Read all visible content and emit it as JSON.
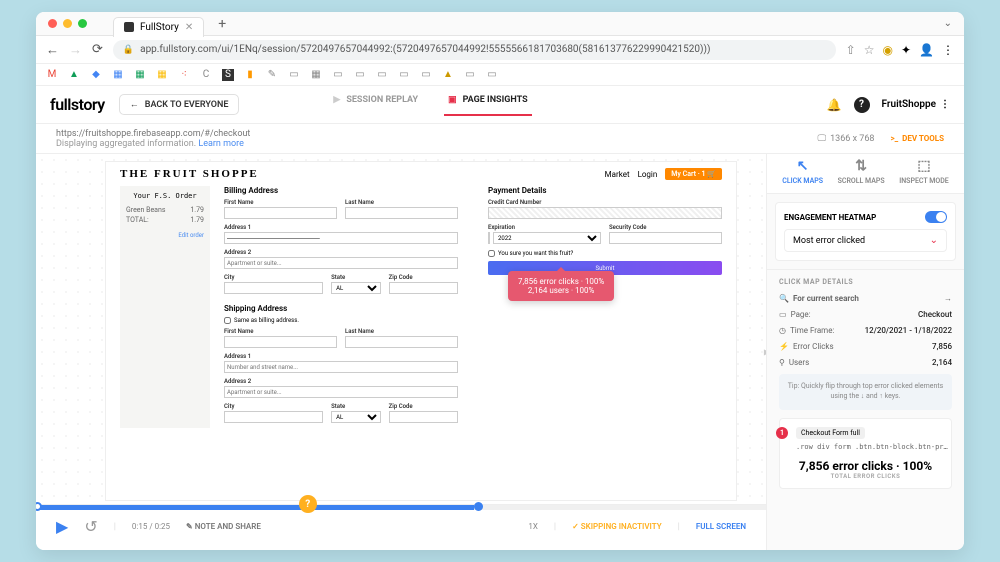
{
  "browser": {
    "tab_title": "FullStory",
    "url": "app.fullstory.com/ui/1ENq/session/5720497657044992:(5720497657044992!5555566181703680(581613776229990421520)))"
  },
  "app_header": {
    "logo": "fullstory",
    "back_button": "BACK TO EVERYONE",
    "nav_replay": "SESSION REPLAY",
    "nav_insights": "PAGE INSIGHTS",
    "user": "FruitShoppe"
  },
  "toolbar": {
    "page_url": "https://fruitshoppe.firebaseapp.com/#/checkout",
    "subtitle": "Displaying aggregated information.",
    "learn_more": "Learn more",
    "dimensions": "1366 x 768",
    "dev_tools": "DEV TOOLS"
  },
  "page": {
    "brand": "THE FRUIT SHOPPE",
    "links": {
      "market": "Market",
      "login": "Login",
      "cart": "My Cart · 1 🛒"
    },
    "order": {
      "title": "Your F.S. Order",
      "items": [
        {
          "name": "Green Beans",
          "price": "1.79"
        }
      ],
      "total_label": "TOTAL:",
      "total": "1.79",
      "edit": "Edit order"
    },
    "billing": {
      "heading": "Billing Address",
      "first_name": "First Name",
      "last_name": "Last Name",
      "address1": "Address 1",
      "address2": "Address 2",
      "address2_ph": "Apartment or suite...",
      "city": "City",
      "state": "State",
      "state_val": "AL",
      "zip": "Zip Code"
    },
    "shipping": {
      "heading": "Shipping Address",
      "same": "Same as billing address.",
      "first_name": "First Name",
      "last_name": "Last Name",
      "address1": "Address 1",
      "address1_ph": "Number and street name...",
      "address2": "Address 2",
      "address2_ph": "Apartment or suite...",
      "city": "City",
      "state": "State",
      "state_val": "AL",
      "zip": "Zip Code"
    },
    "payment": {
      "heading": "Payment Details",
      "card": "Credit Card Number",
      "exp": "Expiration",
      "exp_month": "1",
      "exp_year": "2022",
      "cvv": "Security Code",
      "check": "You sure you want this fruit?",
      "submit": "Submit"
    }
  },
  "popover": {
    "line1": "7,856 error clicks · 100%",
    "line2": "2,164 users · 100%"
  },
  "playbar": {
    "time": "0:15 / 0:25",
    "note": "NOTE AND SHARE",
    "speed": "1X",
    "skip": "SKIPPING INACTIVITY",
    "fullscreen": "FULL SCREEN",
    "badge": "?"
  },
  "panel": {
    "modes": {
      "click": "CLICK MAPS",
      "scroll": "SCROLL MAPS",
      "inspect": "INSPECT MODE"
    },
    "heatmap": {
      "title": "ENGAGEMENT HEATMAP",
      "dropdown": "Most error clicked"
    },
    "details": {
      "title": "CLICK MAP DETAILS",
      "search": "For current search",
      "rows": {
        "page_l": "Page:",
        "page_v": "Checkout",
        "time_l": "Time Frame:",
        "time_v": "12/20/2021 - 1/18/2022",
        "err_l": "Error Clicks",
        "err_v": "7,856",
        "users_l": "Users",
        "users_v": "2,164"
      },
      "tip": "Tip: Quickly flip through top error clicked elements using the ↓ and ↑ keys."
    },
    "card": {
      "num": "1",
      "tag": "Checkout Form full",
      "selector": ".row div form .btn.btn-block.btn-primary.ct...",
      "big": "7,856 error clicks · 100%",
      "small": "TOTAL ERROR CLICKS"
    }
  }
}
